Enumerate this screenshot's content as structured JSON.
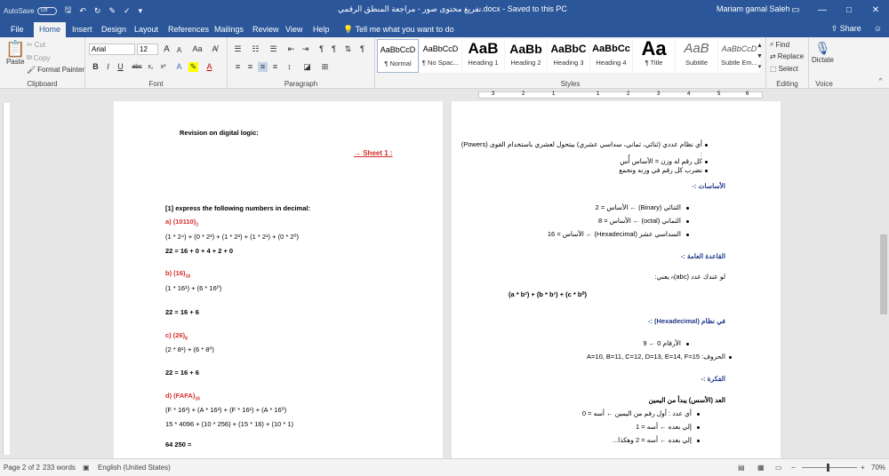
{
  "titlebar": {
    "autosave_label": "AutoSave",
    "autosave_state": "Off",
    "document_title": "تفريغ محتوى صور - مراجعة المنطق الرقمي.docx  -  Saved to this PC",
    "user": "Mariam gamal Saleh"
  },
  "tabs": [
    "File",
    "Home",
    "Insert",
    "Design",
    "Layout",
    "References",
    "Mailings",
    "Review",
    "View",
    "Help"
  ],
  "tell_me": "Tell me what you want to do",
  "share": "Share",
  "ribbon": {
    "clipboard": {
      "label": "Clipboard",
      "paste": "Paste",
      "cut": "Cut",
      "copy": "Copy",
      "format_painter": "Format Painter"
    },
    "font": {
      "label": "Font",
      "name": "Arial",
      "size": "12",
      "grow": "A",
      "shrink": "A",
      "case": "Aa",
      "bold": "B",
      "italic": "I",
      "underline": "U",
      "strike": "abc",
      "sub": "x₂",
      "sup": "x²"
    },
    "paragraph": {
      "label": "Paragraph"
    },
    "styles": {
      "label": "Styles",
      "items": [
        {
          "preview": "AaBbCcD",
          "name": "¶ Normal"
        },
        {
          "preview": "AaBbCcD",
          "name": "¶ No Spac..."
        },
        {
          "preview": "AaB",
          "name": "Heading 1"
        },
        {
          "preview": "AaBb",
          "name": "Heading 2"
        },
        {
          "preview": "AaBbC",
          "name": "Heading 3"
        },
        {
          "preview": "AaBbCc",
          "name": "Heading 4"
        },
        {
          "preview": "Aa",
          "name": "¶ Title"
        },
        {
          "preview": "AaB",
          "name": "Subtitle"
        },
        {
          "preview": "AaBbCcD",
          "name": "Subtle Em..."
        }
      ]
    },
    "editing": {
      "label": "Editing",
      "find": "Find",
      "replace": "Replace",
      "select": "Select"
    },
    "voice": {
      "label": "Voice",
      "dictate": "Dictate"
    }
  },
  "ruler": {
    "numbers": [
      "3",
      "2",
      "1",
      "1",
      "2",
      "3",
      "4",
      "5",
      "6",
      "7"
    ]
  },
  "left_page": {
    "title": "Revision on digital logic:",
    "sheet": "→ Sheet 1 :",
    "question": "[1] express the following numbers in decimal:",
    "a_head": "a) (10110)",
    "a_sub": "2",
    "a_line1": "(1 * 2⁴) + (0 * 2³) + (1 * 2²) + (1 * 2¹) + (0 * 2⁰)",
    "a_line2": "22 = 16 + 0 + 4 + 2 + 0",
    "b_head": "b) (16)",
    "b_sub": "16",
    "b_line1": "(1 * 16¹) + (6 * 16⁰)",
    "b_line2": "22 = 16 + 6",
    "c_head": "c) (26)",
    "c_sub": "8",
    "c_line1": "(2 * 8¹) + (6 * 8⁰)",
    "c_line2": "22 = 16 + 6",
    "d_head": "d) (FAFA)",
    "d_sub": "16",
    "d_line1": "(F * 16³) + (A * 16²) + (F * 16¹) + (A * 16⁰)",
    "d_line2": "15 * 4096 + (10 * 256) + (15 * 16) + (10 * 1)",
    "d_line3": "64 250 ="
  },
  "right_page": {
    "bullets1": [
      "أي نظام عددي (ثنائي، ثماني، سداسي عشري) بيتحول لعشري باستخدام القوى (Powers)",
      ":",
      "كل رقم له وزن = الأساس أُس",
      "نضرب كل رقم في وزنه ونجمع"
    ],
    "h_basics": "الأساسات :-",
    "bases": [
      "الثنائي (Binary) ← الأساس = 2",
      "الثماني (octal) ← الأساس = 8",
      "السداسي عشر (Hexadecimal) ← الأساس = 16"
    ],
    "h_rule": "القاعدة العامة :-",
    "rule_text": "لو عندك عدد (abc)ₙ يعني:",
    "formula": "(a * b²) + (b * b¹) + (c * b⁰)",
    "h_hex": "في نظام (Hexadecimal) :-",
    "hex_bullets": [
      "الأرقام 0 ← 9",
      "الحروف: A=10, B=11, C=12, D=13, E=14, F=15"
    ],
    "h_idea": "الفكرة :-",
    "idea_head": "العد (الأسس) يبدأ من اليمين",
    "idea_bullets": [
      "أي عدد : أول رقم من اليمين ← أسه = 0",
      "إلي بعده ← أسه = 1",
      "إلي بعده ← أسه = 2 وهكذا..."
    ]
  },
  "status": {
    "page": "Page 2 of 2",
    "words": "233 words",
    "language": "English (United States)",
    "zoom": "70%"
  }
}
